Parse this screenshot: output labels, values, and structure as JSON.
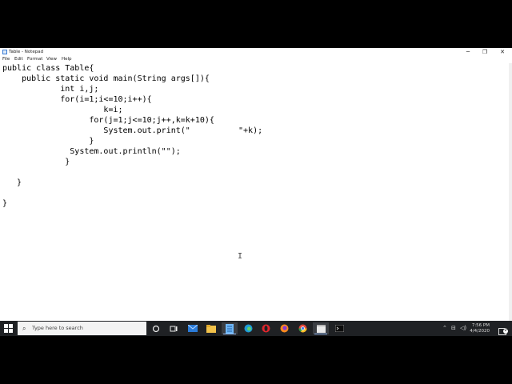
{
  "window": {
    "title": "Table - Notepad",
    "controls": [
      "─",
      "❐",
      "✕"
    ]
  },
  "menu": [
    "File",
    "Edit",
    "Format",
    "View",
    "Help"
  ],
  "editor": {
    "lines": [
      "public class Table{",
      "    public static void main(String args[]){",
      "            int i,j;",
      "            for(i=1;i<=10;i++){",
      "                     k=i;",
      "                  for(j=1;j<=10;j++,k=k+10){",
      "                     System.out.print(\"          \"+k);",
      "                  }",
      "              System.out.println(\"\");",
      "             }",
      "",
      "   }",
      "",
      "}"
    ]
  },
  "taskbar": {
    "search_placeholder": "Type here to search",
    "apps": [
      {
        "name": "task-view-icon",
        "glyph": "○"
      },
      {
        "name": "multitasking-icon",
        "glyph": "⧉"
      },
      {
        "name": "mail-icon",
        "glyph": "✉"
      },
      {
        "name": "file-explorer-icon",
        "glyph": "▇"
      },
      {
        "name": "notepad-icon",
        "glyph": "▤"
      },
      {
        "name": "edge-icon",
        "glyph": "◐"
      },
      {
        "name": "opera-icon",
        "glyph": "O"
      },
      {
        "name": "firefox-icon",
        "glyph": "●"
      },
      {
        "name": "chrome-icon",
        "glyph": "◉"
      },
      {
        "name": "app-window-icon",
        "glyph": "▢"
      },
      {
        "name": "terminal-icon",
        "glyph": "▬"
      }
    ],
    "tray": {
      "chevron": "⌃",
      "network": "⊟",
      "volume": "◁)",
      "time": "7:56 PM",
      "date": "4/4/2020",
      "notification_count": "2"
    }
  },
  "colors": {
    "taskbar": "#1f2124",
    "active_underline": "#9cc3ff",
    "search_box": "#f3f3f3"
  }
}
